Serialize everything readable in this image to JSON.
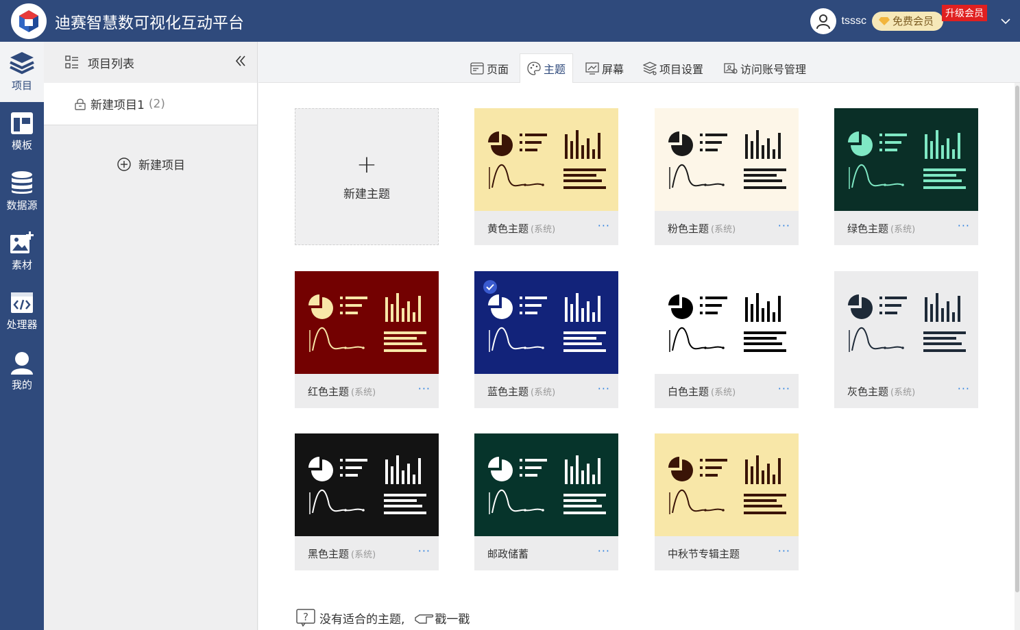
{
  "header": {
    "title": "迪赛智慧数可视化互动平台",
    "username": "tsssc",
    "member_label": "免费会员",
    "upgrade_label": "升级会员"
  },
  "leftnav": [
    {
      "label": "项目",
      "icon": "layers-icon",
      "active": true
    },
    {
      "label": "模板",
      "icon": "template-icon",
      "active": false
    },
    {
      "label": "数据源",
      "icon": "database-icon",
      "active": false
    },
    {
      "label": "素材",
      "icon": "image-add-icon",
      "active": false
    },
    {
      "label": "处理器",
      "icon": "code-icon",
      "active": false
    },
    {
      "label": "我的",
      "icon": "user-icon",
      "active": false
    }
  ],
  "projects": {
    "header": "项目列表",
    "items": [
      {
        "name": "新建项目1",
        "count": "(2)"
      }
    ],
    "new_label": "新建项目"
  },
  "tabs": [
    {
      "label": "页面",
      "icon": "page-icon",
      "active": false
    },
    {
      "label": "主题",
      "icon": "palette-icon",
      "active": true
    },
    {
      "label": "屏幕",
      "icon": "screen-icon",
      "active": false
    },
    {
      "label": "项目设置",
      "icon": "settings-layers-icon",
      "active": false
    },
    {
      "label": "访问账号管理",
      "icon": "account-icon",
      "active": false
    }
  ],
  "new_theme_label": "新建主题",
  "system_tag": "(系统)",
  "more_label": "···",
  "themes": [
    {
      "name": "黄色主题",
      "system": true,
      "bg": "#f8e7a8",
      "fg": "#3a1407",
      "selected": false
    },
    {
      "name": "粉色主题",
      "system": true,
      "bg": "#fdf6e8",
      "fg": "#1a1a1a",
      "selected": false
    },
    {
      "name": "绿色主题",
      "system": true,
      "bg": "#0a2f27",
      "fg": "#7fe8c4",
      "selected": false
    },
    {
      "name": "红色主题",
      "system": true,
      "bg": "#730101",
      "fg": "#f8e7a8",
      "selected": false
    },
    {
      "name": "蓝色主题",
      "system": true,
      "bg": "#12237a",
      "fg": "#ffffff",
      "selected": true
    },
    {
      "name": "白色主题",
      "system": true,
      "bg": "#ffffff",
      "fg": "#000000",
      "selected": false
    },
    {
      "name": "灰色主题",
      "system": true,
      "bg": "#ececed",
      "fg": "#1e2a38",
      "selected": false
    },
    {
      "name": "黑色主题",
      "system": true,
      "bg": "#131313",
      "fg": "#ffffff",
      "selected": false
    },
    {
      "name": "邮政储蓄",
      "system": false,
      "bg": "#06342b",
      "fg": "#ffffff",
      "selected": false
    },
    {
      "name": "中秋节专辑主题",
      "system": false,
      "bg": "#f8e7a8",
      "fg": "#3a1407",
      "selected": false
    }
  ],
  "bottom": {
    "hint": "没有适合的主题,",
    "action": "戳一戳"
  }
}
